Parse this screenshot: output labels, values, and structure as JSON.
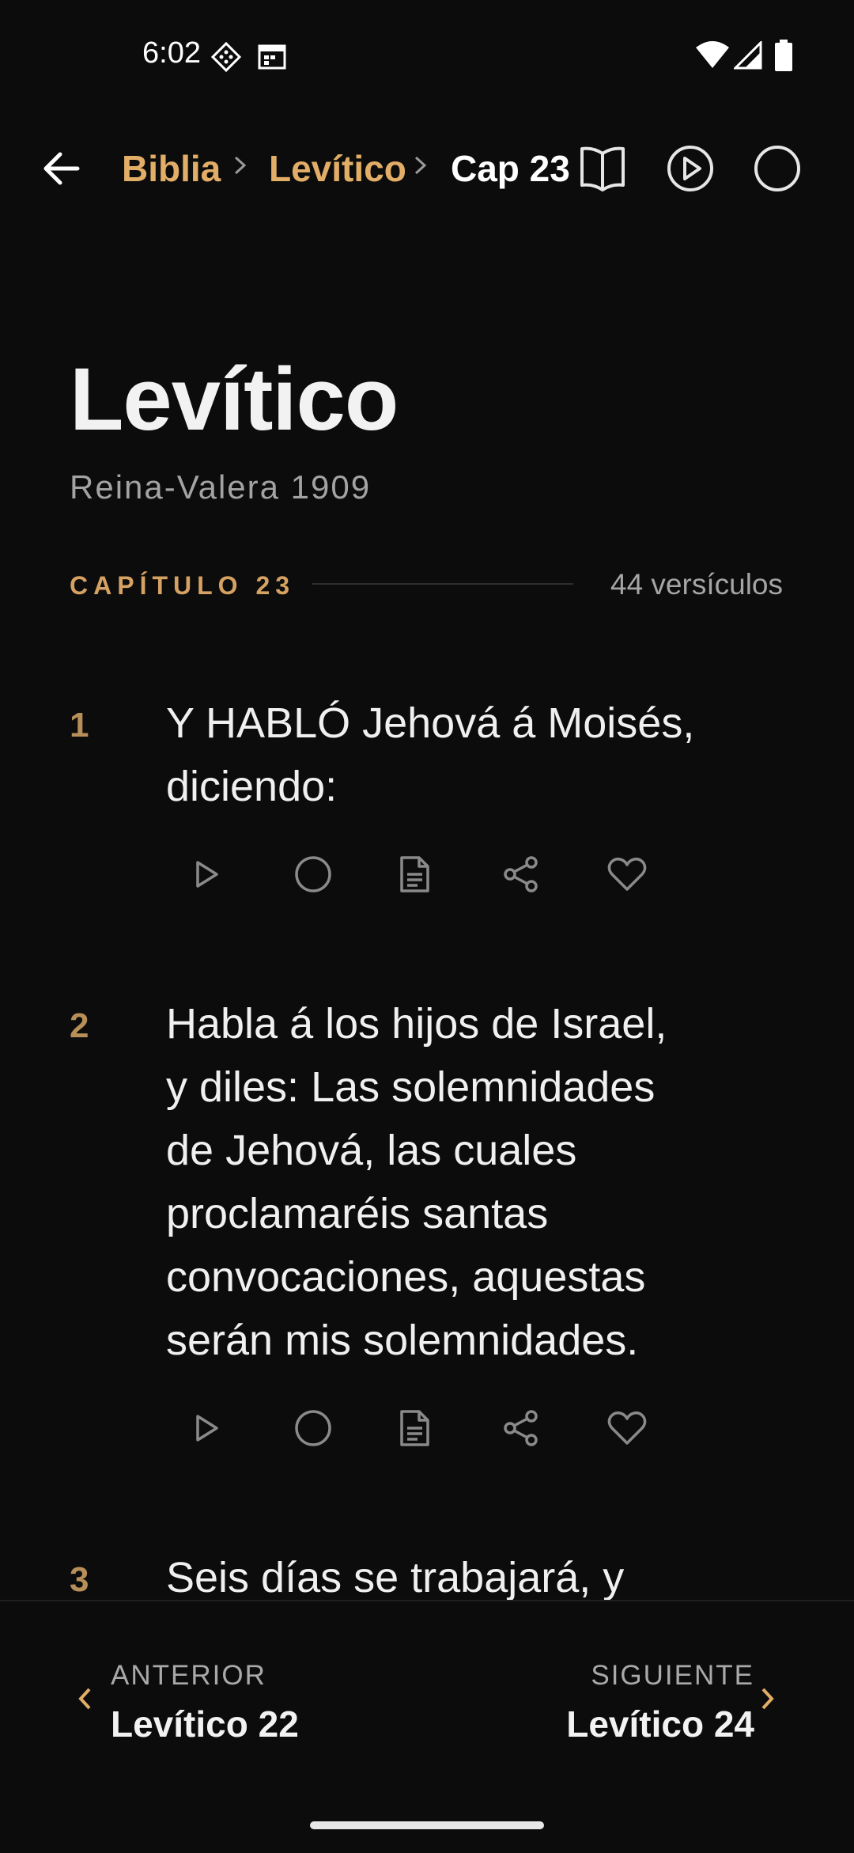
{
  "status_bar": {
    "time": "6:02"
  },
  "breadcrumb": {
    "root": "Biblia",
    "book": "Levítico",
    "chapter": "Cap 23"
  },
  "header_icons": [
    "back-arrow-icon",
    "book-open-icon",
    "play-circle-icon",
    "circle-icon"
  ],
  "title": {
    "book": "Levítico",
    "version": "Reina-Valera 1909"
  },
  "chapter": {
    "label": "CAPÍTULO 23",
    "verse_count": "44 versículos"
  },
  "verses": [
    {
      "number": "1",
      "lines": [
        "Y HABLÓ Jehová á Moisés,",
        "diciendo:"
      ]
    },
    {
      "number": "2",
      "lines": [
        "Habla á los hijos de Israel,",
        "y diles: Las solemnidades",
        "de Jehová, las cuales",
        "proclamaréis santas",
        "convocaciones, aquestas",
        "serán mis solemnidades."
      ]
    },
    {
      "number": "3",
      "lines": [
        "Seis días se trabajará, y"
      ]
    }
  ],
  "verse_action_icons": [
    "play-icon",
    "circle-icon",
    "document-icon",
    "share-icon",
    "heart-icon"
  ],
  "navigation": {
    "previous_label": "ANTERIOR",
    "previous_chapter": "Levítico 22",
    "next_label": "SIGUIENTE",
    "next_chapter": "Levítico 24"
  },
  "colors": {
    "background": "#0c0c0c",
    "accent_gold": "#e2ad66",
    "verse_number": "#b88f58",
    "text": "#f0f0f0"
  }
}
